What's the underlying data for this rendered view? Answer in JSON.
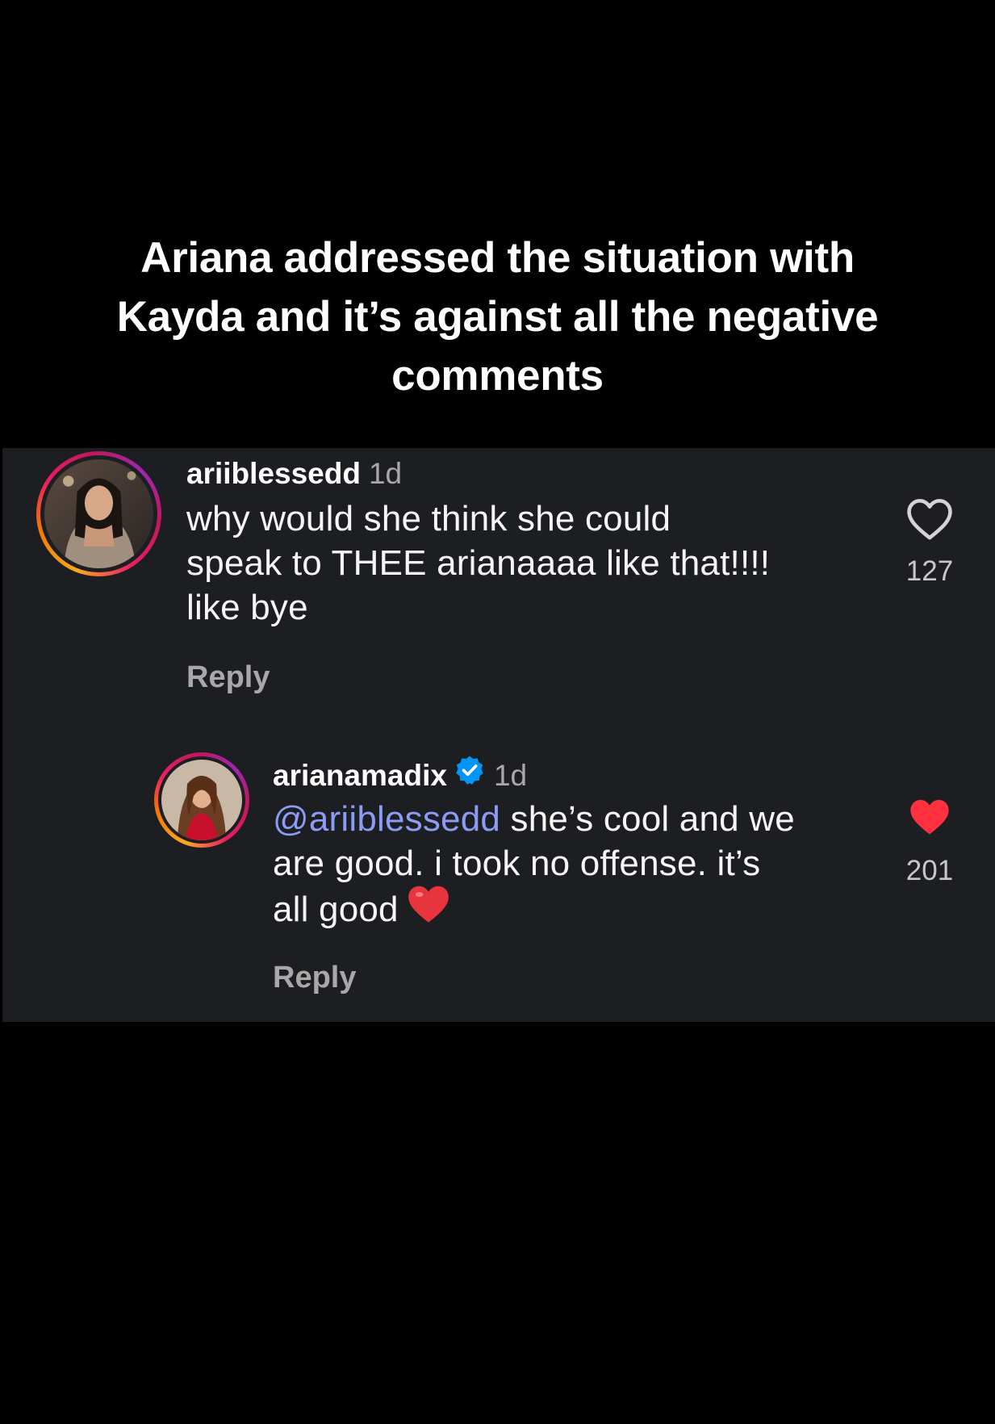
{
  "caption": {
    "line1": "Ariana addressed the situation with",
    "line2": "Kayda and it’s against all the negative",
    "line3": "comments"
  },
  "comments": [
    {
      "username": "ariiblessedd",
      "time": "1d",
      "lines": [
        "why would she think she could",
        "speak to THEE arianaaaa like that!!!!",
        "like bye"
      ],
      "reply_label": "Reply",
      "like_count": "127",
      "liked": false
    },
    {
      "username": "arianamadix",
      "verified": true,
      "time": "1d",
      "mention": "@ariiblessedd",
      "line1_rest": " she’s cool and we",
      "line2": "are good. i took no offense. it’s",
      "line3": "all good",
      "reply_label": "Reply",
      "like_count": "201",
      "liked": true
    }
  ],
  "colors": {
    "background": "#000000",
    "panel": "#1c1e22",
    "mention": "#8c9bf5",
    "liked_heart": "#ff3040",
    "verified_badge": "#0095f6"
  },
  "icons": {
    "like_outline": "heart-outline-icon",
    "like_filled": "heart-filled-icon",
    "verified": "verified-badge-icon",
    "emoji": "red-heart-emoji"
  }
}
